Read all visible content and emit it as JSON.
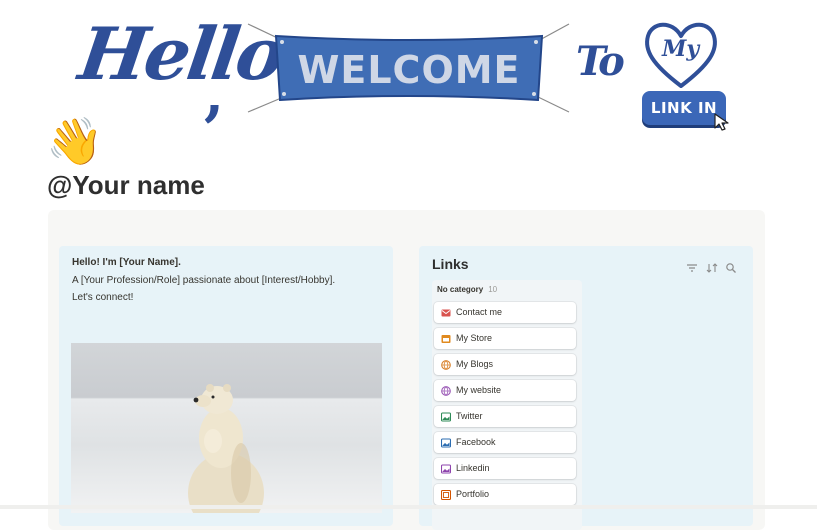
{
  "banner": {
    "hello": "Hello",
    "hello_comma": ",",
    "welcome": "WELCOME",
    "to": "To",
    "heart_text": "My",
    "link_in_bio": "LINK IN BIO",
    "colors": {
      "brand_blue": "#2f4f98",
      "button_blue": "#3b67b8"
    }
  },
  "page": {
    "emoji": "👋",
    "title": "@Your name"
  },
  "bio": {
    "greeting": "Hello! I'm [Your Name].",
    "profession": "A [Your Profession/Role] passionate about [Interest/Hobby].",
    "cta": "Let's connect!"
  },
  "links": {
    "title": "Links",
    "tools": [
      "filter-icon",
      "sort-icon",
      "search-icon"
    ],
    "group": {
      "name": "No category",
      "count": "10"
    },
    "items": [
      {
        "label": "Contact me",
        "icon": "envelope-icon",
        "color": "#d9534f"
      },
      {
        "label": "My Store",
        "icon": "store-icon",
        "color": "#e08a1e"
      },
      {
        "label": "My Blogs",
        "icon": "globe-icon",
        "color": "#d9822b"
      },
      {
        "label": "My website",
        "icon": "globe-icon",
        "color": "#9b59b6"
      },
      {
        "label": "Twitter",
        "icon": "image-icon",
        "color": "#2e8b57"
      },
      {
        "label": "Facebook",
        "icon": "image-icon",
        "color": "#2b6cb0"
      },
      {
        "label": "Linkedin",
        "icon": "image-icon",
        "color": "#8e44ad"
      },
      {
        "label": "Portfolio",
        "icon": "frame-icon",
        "color": "#d35400"
      }
    ]
  }
}
